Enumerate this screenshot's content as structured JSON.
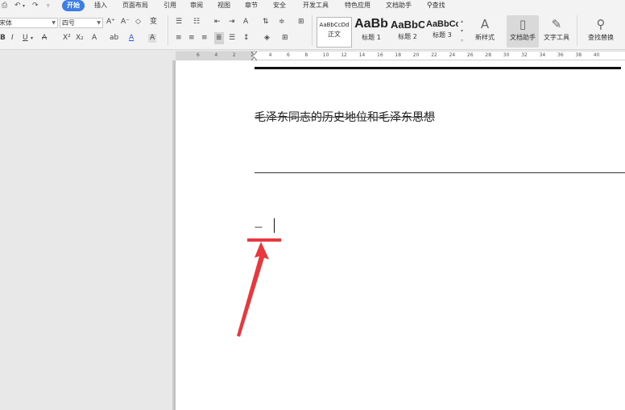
{
  "menubar": {
    "tabs": [
      {
        "label": "开始"
      },
      {
        "label": "插入"
      },
      {
        "label": "页面布局"
      },
      {
        "label": "引用"
      },
      {
        "label": "审阅"
      },
      {
        "label": "视图"
      },
      {
        "label": "章节"
      },
      {
        "label": "安全"
      },
      {
        "label": "开发工具"
      },
      {
        "label": "特色应用"
      },
      {
        "label": "文档助手"
      }
    ],
    "search_label": "查找"
  },
  "ribbon": {
    "font_name": "宋体",
    "font_size": "四号",
    "styles": [
      {
        "preview": "AaBbCcDd",
        "label": "正文"
      },
      {
        "preview": "AaBb",
        "label": "标题 1"
      },
      {
        "preview": "AaBbC",
        "label": "标题 2"
      },
      {
        "preview": "AaBbCc",
        "label": "标题 3"
      }
    ],
    "new_style_label": "新样式",
    "doc_assistant_label": "文档助手",
    "text_tools_label": "文字工具",
    "find_replace_label": "查找替换"
  },
  "ruler": {
    "numbers": [
      "6",
      "4",
      "2",
      "2",
      "4",
      "6",
      "8",
      "10",
      "12",
      "14",
      "16",
      "18",
      "20",
      "22",
      "24",
      "26",
      "28",
      "30",
      "32",
      "34",
      "36",
      "38",
      "40"
    ]
  },
  "document": {
    "title": "毛泽东同志的历史地位和毛泽东思想",
    "typed_text": "---"
  },
  "colors": {
    "accent": "#3b7de9",
    "annotation_red": "#e8383d"
  }
}
